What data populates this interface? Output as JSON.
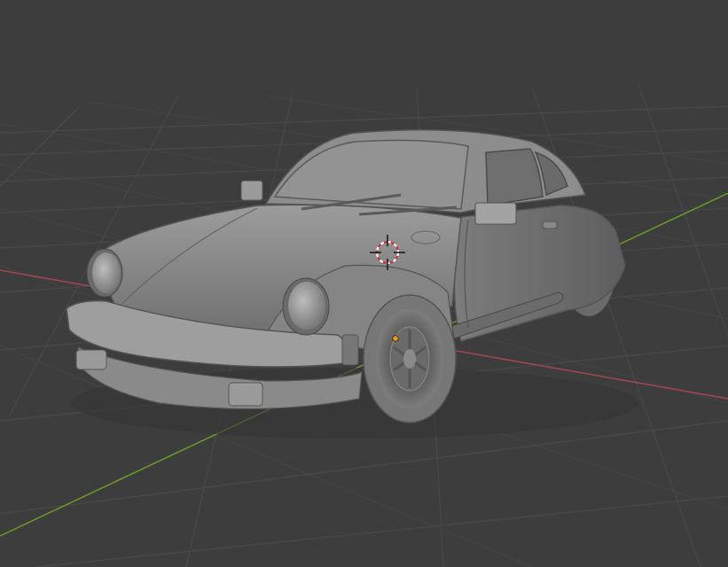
{
  "viewport": {
    "background": "#3d3d3d",
    "grid_color": "#4a4a4a",
    "x_axis_color": "#a4474f",
    "y_axis_color": "#6a9a2a"
  },
  "scene": {
    "object": "car-model",
    "shading": "solid",
    "model_color": "#8a8a8a",
    "cursor": "3d-cursor-icon",
    "origin": "object-origin-dot"
  }
}
